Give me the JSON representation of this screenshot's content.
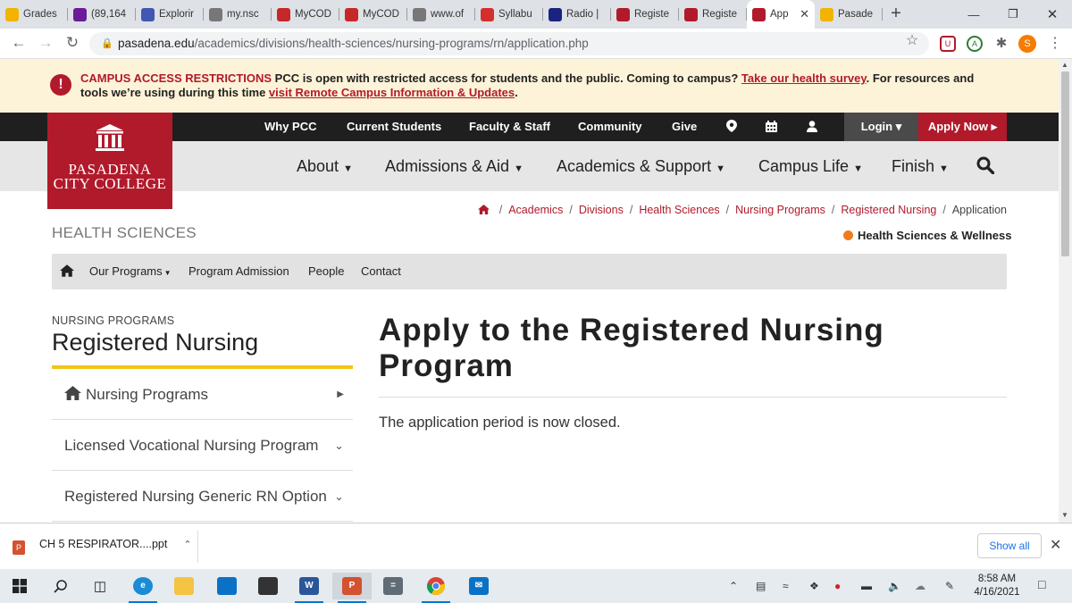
{
  "browser": {
    "tabs": [
      {
        "label": "Grades",
        "icon": "grades-icon",
        "color": "#f2b400"
      },
      {
        "label": "(89,164",
        "icon": "mail-icon",
        "color": "#6a1b9a"
      },
      {
        "label": "Explorir",
        "icon": "quizlet-icon",
        "color": "#4257b2"
      },
      {
        "label": "my.nsc",
        "icon": "globe-icon",
        "color": "#777777"
      },
      {
        "label": "MyCOD",
        "icon": "cod-icon",
        "color": "#c62828"
      },
      {
        "label": "MyCOD",
        "icon": "cod-icon",
        "color": "#c62828"
      },
      {
        "label": "www.of",
        "icon": "globe-icon",
        "color": "#777777"
      },
      {
        "label": "Syllabu",
        "icon": "syllabus-icon",
        "color": "#d32f2f"
      },
      {
        "label": "Radio |",
        "icon": "d2l-icon",
        "color": "#1a237e"
      },
      {
        "label": "Registe",
        "icon": "pcc-icon",
        "color": "#b11a2b"
      },
      {
        "label": "Registe",
        "icon": "pcc-icon",
        "color": "#b11a2b"
      },
      {
        "label": "App",
        "icon": "pcc-icon",
        "color": "#b11a2b",
        "active": true
      },
      {
        "label": "Pasade",
        "icon": "pasadena-icon",
        "color": "#f2b400"
      }
    ],
    "url_host": "pasadena.edu",
    "url_path": "/academics/divisions/health-sciences/nursing-programs/rn/application.php",
    "profile_initial": "S"
  },
  "alert": {
    "title": "CAMPUS ACCESS RESTRICTIONS",
    "text1": " PCC is open with restricted access for students and the public. Coming to campus? ",
    "link1": "Take our health survey",
    "text2": ". For resources and tools we’re using during this time ",
    "link2": "visit Remote Campus Information & Updates",
    "text3": "."
  },
  "topnav": {
    "items": [
      "Why PCC",
      "Current Students",
      "Faculty & Staff",
      "Community",
      "Give"
    ],
    "login": "Login ▾",
    "apply": "Apply Now ▸"
  },
  "logo": {
    "line1": "PASADENA",
    "line2": "CITY COLLEGE"
  },
  "mainnav": [
    "About",
    "Admissions & Aid",
    "Academics & Support",
    "Campus Life",
    "Finish"
  ],
  "breadcrumb": [
    "Academics",
    "Divisions",
    "Health Sciences",
    "Nursing Programs",
    "Registered Nursing"
  ],
  "breadcrumb_current": "Application",
  "division": "Health Sciences & Wellness",
  "dept_title": "HEALTH SCIENCES",
  "subnav": [
    "Our Programs",
    "Program Admission",
    "People",
    "Contact"
  ],
  "sidebar": {
    "kicker": "NURSING PROGRAMS",
    "title": "Registered Nursing",
    "items": [
      {
        "label": "Nursing Programs"
      },
      {
        "label": "Licensed Vocational Nursing Program"
      },
      {
        "label": "Registered Nursing Generic RN Option"
      }
    ]
  },
  "main": {
    "heading": "Apply to the Registered Nursing Program",
    "body": "The application period is now closed."
  },
  "downloads": {
    "file": "CH 5 RESPIRATOR....ppt",
    "show_all": "Show all"
  },
  "taskbar": {
    "time": "8:58 AM",
    "date": "4/16/2021"
  }
}
